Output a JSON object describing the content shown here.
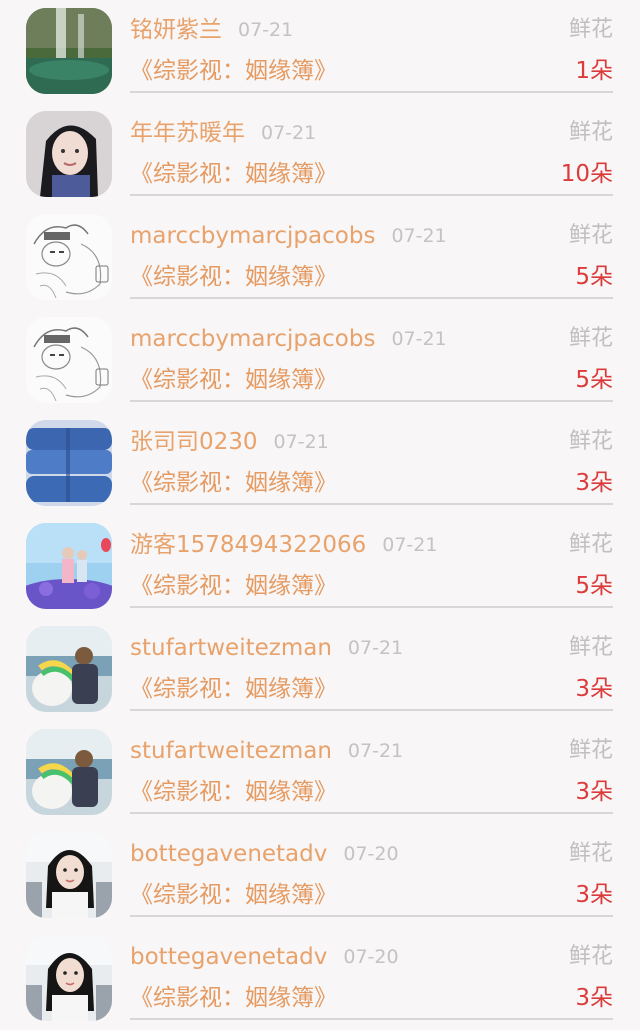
{
  "gifts": [
    {
      "user": "铭妍紫兰",
      "date": "07-21",
      "type": "鲜花",
      "book": "《综影视：姻缘簿》",
      "count": "1朵",
      "avatar": "waterfall-photo"
    },
    {
      "user": "年年苏暖年",
      "date": "07-21",
      "type": "鲜花",
      "book": "《综影视：姻缘簿》",
      "count": "10朵",
      "avatar": "woman-portrait"
    },
    {
      "user": "marccbymarcjpacobs",
      "date": "07-21",
      "type": "鲜花",
      "book": "《综影视：姻缘簿》",
      "count": "5朵",
      "avatar": "manga-sketch"
    },
    {
      "user": "marccbymarcjpacobs",
      "date": "07-21",
      "type": "鲜花",
      "book": "《综影视：姻缘簿》",
      "count": "5朵",
      "avatar": "manga-sketch"
    },
    {
      "user": "张司司0230",
      "date": "07-21",
      "type": "鲜花",
      "book": "《综影视：姻缘簿》",
      "count": "3朵",
      "avatar": "blue-seats"
    },
    {
      "user": "游客1578494322066",
      "date": "07-21",
      "type": "鲜花",
      "book": "《综影视：姻缘簿》",
      "count": "5朵",
      "avatar": "couple-flowers"
    },
    {
      "user": "stufartweitezman",
      "date": "07-21",
      "type": "鲜花",
      "book": "《综影视：姻缘簿》",
      "count": "3朵",
      "avatar": "beach-unicorn"
    },
    {
      "user": "stufartweitezman",
      "date": "07-21",
      "type": "鲜花",
      "book": "《综影视：姻缘簿》",
      "count": "3朵",
      "avatar": "beach-unicorn"
    },
    {
      "user": "bottegavenetadv",
      "date": "07-20",
      "type": "鲜花",
      "book": "《综影视：姻缘簿》",
      "count": "3朵",
      "avatar": "girl-car"
    },
    {
      "user": "bottegavenetadv",
      "date": "07-20",
      "type": "鲜花",
      "book": "《综影视：姻缘簿》",
      "count": "3朵",
      "avatar": "girl-car"
    }
  ],
  "colors": {
    "username": "#e8a26c",
    "date": "#c3c3c3",
    "gift_type": "#c0c0c0",
    "book_title": "#e59a61",
    "count": "#dc3b3b"
  }
}
